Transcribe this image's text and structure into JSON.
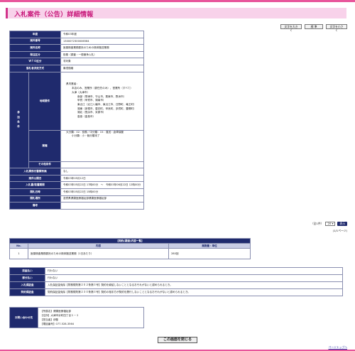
{
  "page": {
    "title": "入札案件（公告）詳細情報"
  },
  "font_buttons": {
    "larger": "文字を大きく",
    "standard": "標 準",
    "smaller": "文字を小さく"
  },
  "details": {
    "fiscal_year": {
      "label": "年度",
      "value": "令和03年度"
    },
    "case_number": {
      "label": "案件番号",
      "value": "1300072300006564"
    },
    "case_name": {
      "label": "案件名称",
      "value": "医薬検査業務委託のための検体搬送業務"
    },
    "order_category": {
      "label": "発注区分",
      "value": "役務（調査・一般競争入札）"
    },
    "wto": {
      "label": "ＷＴＯ区分",
      "value": "非対象"
    },
    "method": {
      "label": "落札者決定方式",
      "value": "最低価格"
    },
    "qualification_label": "参加条件",
    "region": {
      "label": "地域要件",
      "lines": [
        {
          "indent": 1,
          "text": "県内業者："
        },
        {
          "indent": 2,
          "text": "本店のみ、営業所（委任先のみ）、営業所（すべて）"
        },
        {
          "indent": 2,
          "text": "大津（大津市）"
        },
        {
          "indent": 3,
          "text": "南部（草津市、守山市、栗東市、野洲市）"
        },
        {
          "indent": 3,
          "text": "甲賀（甲賀市、湖南市）"
        },
        {
          "indent": 3,
          "text": "東近江（近江八幡市、東近江市、日野町、竜王町）"
        },
        {
          "indent": 3,
          "text": "湖東（彦根市、愛荘町、甲良町、多賀町、豊郷町）"
        },
        {
          "indent": 3,
          "text": "湖北（長浜市、米原市）"
        },
        {
          "indent": 3,
          "text": "高島（高島市）"
        }
      ]
    },
    "industry": {
      "label": "業種",
      "lines": [
        {
          "indent": 1,
          "text": "大分類：02：役務／中分類：15：運送・倉庫保管"
        },
        {
          "indent": 2,
          "text": "小分類：小・個分類未了"
        }
      ]
    },
    "other_conditions": {
      "label": "その他条件",
      "value": ""
    },
    "doc_fee": {
      "label": "入札関係付書類有無",
      "value": "なし"
    },
    "announce_date": {
      "label": "案件公開日",
      "value": "令和03年05月12日"
    },
    "submit_period": {
      "label": "入札書/取書期間",
      "value": "令和03年05月22日 17時00分　〜　令和03年06月22日 12時00分"
    },
    "open_date": {
      "label": "開札日時",
      "value": "令和03年05月22日 15時00分"
    },
    "place": {
      "label": "開札場所",
      "value": "滋賀県健康医療福祉部健康医療福祉部"
    },
    "remarks": {
      "label": "備考",
      "value": ""
    }
  },
  "pager": {
    "label": "（全1件）",
    "per_page": "20",
    "view_button": "表示",
    "page_count": "(1/1ページ)"
  },
  "items_table": {
    "caption": "【契約(調達)内容一覧】",
    "headers": {
      "no": "No.",
      "content": "内容",
      "qty": "業務量・単位"
    },
    "rows": [
      {
        "no": "1",
        "content": "医薬検査業務委託のための検体搬送業務（1日あたり）",
        "qty": "280回"
      }
    ]
  },
  "fees": {
    "prepay": {
      "label": "前金払い",
      "value": "行わない"
    },
    "partial": {
      "label": "部分払い",
      "value": "行わない"
    },
    "bid_bond": {
      "label": "入札保証金",
      "value": "入札保証金免除【財務規則第２０２条第３号】契約を締結しないこととなるおそれがないと認められるとき。"
    },
    "contract_bond": {
      "label": "契約保証金",
      "value": "契約保証金免除【財務規則第２３０条第３号】契約の相手方が契約を履行しないこととなるおそれがないと認められるとき。"
    }
  },
  "contact": {
    "label": "お問い合わせ先",
    "lines": [
      "【所属名】健康医療福祉部",
      "【住所】大津市京町四丁目１－１",
      "【担当者】伊藤",
      "【電話番号】077-528-3564"
    ]
  },
  "buttons": {
    "close": "この画面を閉じる"
  },
  "links": {
    "page_top": "ページトップへ"
  },
  "colors": {
    "accent": "#e8559b",
    "header_blue": "#1f2a6d",
    "title_bg": "#f8d2ea"
  }
}
